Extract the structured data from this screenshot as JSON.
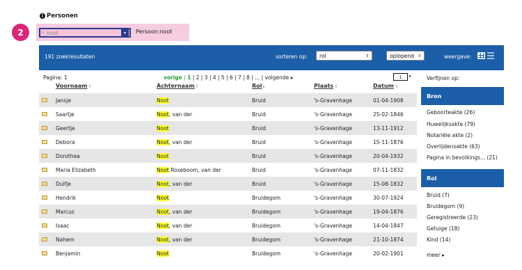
{
  "section": {
    "title": "Personen"
  },
  "step": {
    "number": "2"
  },
  "search": {
    "value": "noot",
    "tag": "Persoon:noot"
  },
  "results": {
    "count_text": "191 zoekresultaten",
    "sort_label": "sorteren op:",
    "sort_value": "rol",
    "order_value": "oplopend",
    "view_label": "weergave:"
  },
  "pagination": {
    "label": "Pagina: 1",
    "prev": "vorige",
    "sep": "|",
    "current": "1",
    "pages": "| 2 | 3 | 4 | 5 | 6 | 7 | 8 | ... |",
    "next": "volgende",
    "next_arrow": "▸",
    "page_input": "1",
    "go_arrow": "▸"
  },
  "columns": [
    {
      "label": "Voornaam",
      "sort_icon": "⇕"
    },
    {
      "label": "Achternaam",
      "sort_icon": "⇕"
    },
    {
      "label": "Rol",
      "sort_icon": "▴"
    },
    {
      "label": "Plaats",
      "sort_icon": "⇕"
    },
    {
      "label": "Datum",
      "sort_icon": "⇕"
    }
  ],
  "rows": [
    {
      "first": "Jansje",
      "last_hl": "Noot",
      "last_rest": "",
      "role": "Bruid",
      "place": "'s-Gravenhage",
      "date": "01-04-1908"
    },
    {
      "first": "Saartje",
      "last_hl": "Noot",
      "last_rest": ", van der",
      "role": "Bruid",
      "place": "'s-Gravenhage",
      "date": "25-02-1846"
    },
    {
      "first": "Geertje",
      "last_hl": "Noot",
      "last_rest": "",
      "role": "Bruid",
      "place": "'s-Gravenhage",
      "date": "13-11-1912"
    },
    {
      "first": "Debora",
      "last_hl": "Noot",
      "last_rest": ", van der",
      "role": "Bruid",
      "place": "'s-Gravenhage",
      "date": "15-11-1876"
    },
    {
      "first": "Dorothea",
      "last_hl": "Noot",
      "last_rest": "",
      "role": "Bruid",
      "place": "'s-Gravenhage",
      "date": "20-04-1932"
    },
    {
      "first": "Maria Elizabeth",
      "last_hl": "Noot",
      "last_rest": " Roseboom, van der",
      "role": "Bruid",
      "place": "'s-Gravenhage",
      "date": "07-11-1832"
    },
    {
      "first": "Duifje",
      "last_hl": "Noot",
      "last_rest": ", van der",
      "role": "Bruid",
      "place": "'s-Gravenhage",
      "date": "15-08-1832"
    },
    {
      "first": "Hendrik",
      "last_hl": "Noot",
      "last_rest": "",
      "role": "Bruidegom",
      "place": "'s-Gravenhage",
      "date": "30-07-1924"
    },
    {
      "first": "Marcus",
      "last_hl": "Noot",
      "last_rest": ", van der",
      "role": "Bruidegom",
      "place": "'s-Gravenhage",
      "date": "19-04-1876"
    },
    {
      "first": "Isaac",
      "last_hl": "Noot",
      "last_rest": ", van der",
      "role": "Bruidegom",
      "place": "'s-Gravenhage",
      "date": "14-04-1847"
    },
    {
      "first": "Nahem",
      "last_hl": "Noot",
      "last_rest": ", van der",
      "role": "Bruidegom",
      "place": "'s-Gravenhage",
      "date": "21-10-1874"
    },
    {
      "first": "Benjamin",
      "last_hl": "Noot",
      "last_rest": "",
      "role": "Bruidegom",
      "place": "'s-Gravenhage",
      "date": "20-02-1901"
    }
  ],
  "refine": {
    "label": "Verfijnen op:",
    "bron_title": "Bron",
    "bron": [
      "Geboorteakte (26)",
      "Huwelijksakte (79)",
      "Notariële akte (2)",
      "Overlijdensakte (63)",
      "Pagina in bevolkings... (21)"
    ],
    "rol_title": "Rol",
    "rol": [
      "Bruid (7)",
      "Bruidegom (9)",
      "Geregistreerde (23)",
      "Getuige (18)",
      "Kind (14)"
    ],
    "more": "meer ▸"
  },
  "colors": {
    "brand_blue": "#1c5ea8",
    "highlight": "#ffff2e",
    "badge_pink": "#d92679",
    "pager_green": "#2a9d3a"
  }
}
